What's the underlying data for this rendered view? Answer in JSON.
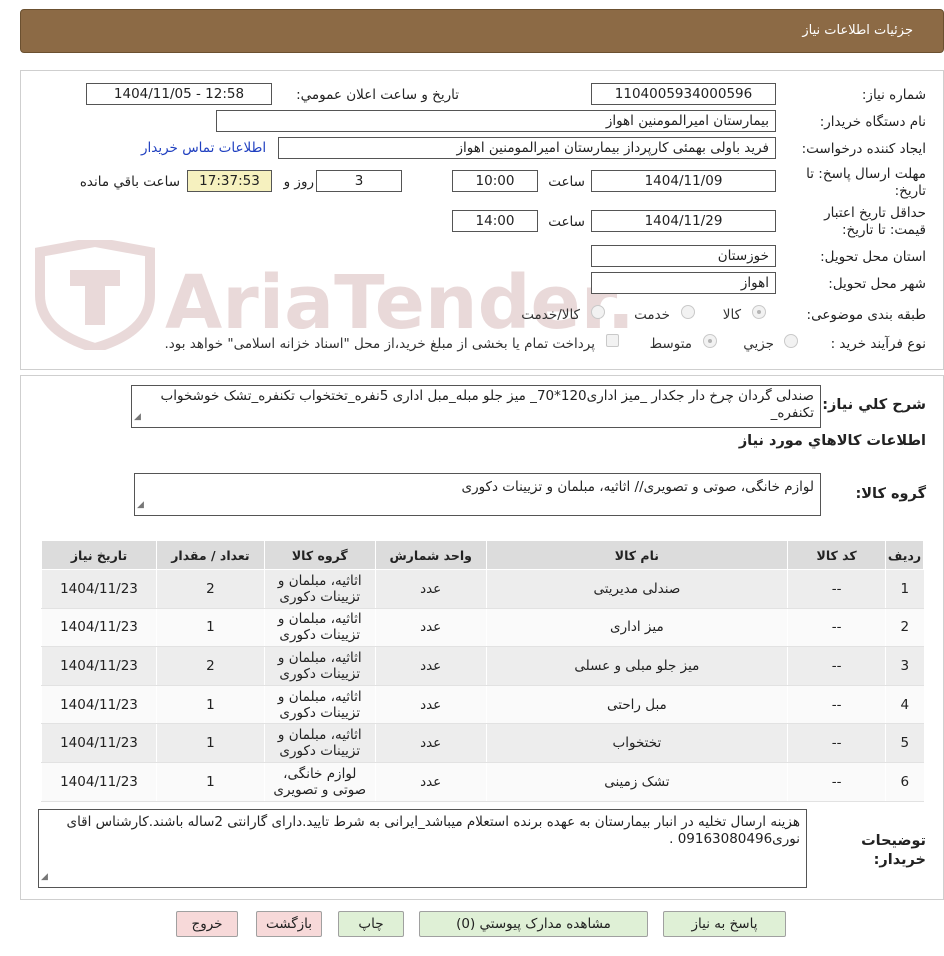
{
  "header": {
    "title": "جزئیات اطلاعات نیاز"
  },
  "form": {
    "need_number_label": "شماره نیاز:",
    "need_number": "1104005934000596",
    "announce_label": "تاریخ و ساعت اعلان عمومي:",
    "announce_value": "1404/11/05 - 12:58",
    "buyer_org_label": "نام دستگاه خريدار:",
    "buyer_org": "بيمارستان اميرالمومنين اهواز",
    "requester_label": "ايجاد کننده درخواست:",
    "requester": "فريد باولی بهمئی کارپرداز بيمارستان اميرالمومنين اهواز",
    "contact_link": "اطلاعات تماس خريدار",
    "deadline_label": "مهلت ارسال پاسخ: تا تاريخ:",
    "deadline_date": "1404/11/09",
    "time_label": "ساعت",
    "deadline_time": "10:00",
    "days_value": "3",
    "days_label": "روز و",
    "remaining_time": "17:37:53",
    "remaining_label": "ساعت باقي مانده",
    "validity_label": "حداقل تاريخ اعتبار قيمت: تا تاريخ:",
    "validity_date": "1404/11/29",
    "validity_time": "14:00",
    "province_label": "استان محل تحويل:",
    "province": "خوزستان",
    "city_label": "شهر محل تحويل:",
    "city": "اهواز",
    "category_label": "طبقه بندی موضوعی:",
    "category_options": [
      "کالا",
      "خدمت",
      "کالا/خدمت"
    ],
    "category_selected": "کالا",
    "process_label": "نوع فرآيند خريد :",
    "process_options": [
      "جزيي",
      "متوسط"
    ],
    "process_selected": "متوسط",
    "payment_note": "پرداخت تمام يا بخشی از مبلغ خريد،از محل \"اسناد خزانه اسلامی\" خواهد بود."
  },
  "details": {
    "summary_label": "شرح کلي نياز:",
    "summary": "صندلی گردان چرخ دار جکدار _میز اداری120*70_ میز جلو مبله_مبل اداری 5نفره_تختخواب تکنفره_تشک خوشخواب تکنفره_",
    "goods_info_title": "اطلاعات کالاهاي مورد نياز",
    "goods_group_label": "گروه کالا:",
    "goods_group": "لوازم خانگی، صوتی و تصویری// اثاثیه، مبلمان و تزیینات دکوری"
  },
  "table": {
    "headers": [
      "رديف",
      "کد کالا",
      "نام کالا",
      "واحد شمارش",
      "گروه کالا",
      "تعداد / مقدار",
      "تاريخ نياز"
    ],
    "rows": [
      [
        "1",
        "--",
        "صندلی مدیریتی",
        "عدد",
        "اثاثیه، مبلمان و تزیینات دکوری",
        "2",
        "1404/11/23"
      ],
      [
        "2",
        "--",
        "میز اداری",
        "عدد",
        "اثاثیه، مبلمان و تزیینات دکوری",
        "1",
        "1404/11/23"
      ],
      [
        "3",
        "--",
        "میز جلو مبلی و عسلی",
        "عدد",
        "اثاثیه، مبلمان و تزیینات دکوری",
        "2",
        "1404/11/23"
      ],
      [
        "4",
        "--",
        "مبل راحتی",
        "عدد",
        "اثاثیه، مبلمان و تزیینات دکوری",
        "1",
        "1404/11/23"
      ],
      [
        "5",
        "--",
        "تختخواب",
        "عدد",
        "اثاثیه، مبلمان و تزیینات دکوری",
        "1",
        "1404/11/23"
      ],
      [
        "6",
        "--",
        "تشک زمینی",
        "عدد",
        "لوازم خانگی، صوتی و تصویری",
        "1",
        "1404/11/23"
      ]
    ]
  },
  "buyer_notes": {
    "label": "توضيحات خريدار:",
    "text": "هزینه ارسال تخلیه در انبار بیمارستان به عهده برنده استعلام میباشد_ایرانی به شرط تایید.دارای گارانتی 2ساله باشند.کارشناس اقای نوری09163080496 ."
  },
  "buttons": {
    "reply": "پاسخ به نياز",
    "attachments": "مشاهده مدارک پيوستي (0)",
    "print": "چاپ",
    "back": "بازگشت",
    "exit": "خروج"
  },
  "watermark": {
    "text": "AriaTender.neT"
  }
}
